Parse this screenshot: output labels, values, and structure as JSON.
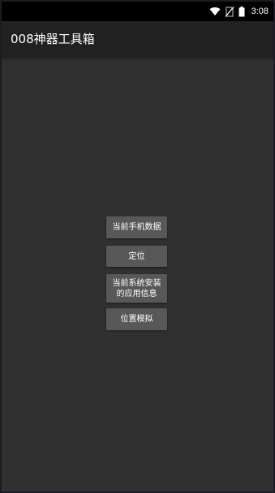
{
  "status_bar": {
    "time": "3:08",
    "icons": [
      "wifi-icon",
      "no-sim-icon",
      "battery-icon"
    ]
  },
  "app_bar": {
    "title": "008神器工具箱"
  },
  "buttons": [
    {
      "label": "当前手机数据"
    },
    {
      "label": "定位"
    },
    {
      "label": "当前系统安装\n的应用信息"
    },
    {
      "label": "位置模拟"
    }
  ],
  "colors": {
    "background": "#303030",
    "app_bar": "#212121",
    "status_bar": "#000000",
    "button": "#585858",
    "text": "#ffffff"
  }
}
